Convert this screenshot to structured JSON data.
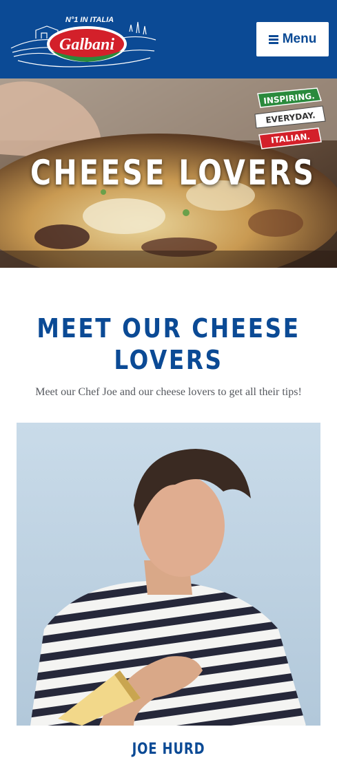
{
  "header": {
    "logo": {
      "badge_text": "N°1 IN ITALIA",
      "brand": "Galbani"
    },
    "menu_label": "Menu",
    "background": "#0b4a95"
  },
  "hero": {
    "title": "CHEESE LOVERS",
    "ribbon": [
      "INSPIRING.",
      "EVERYDAY.",
      "ITALIAN."
    ]
  },
  "main": {
    "title_line1": "MEET OUR CHEESE",
    "title_line2": "LOVERS",
    "intro": "Meet our Chef Joe and our cheese lovers to get all their tips!",
    "chefs": [
      {
        "name": "JOE HURD"
      }
    ]
  },
  "colors": {
    "brand_blue": "#0b4a95",
    "brand_red": "#d3202a",
    "brand_green": "#2a8a3c"
  },
  "icons": {
    "menu": "hamburger-icon"
  }
}
